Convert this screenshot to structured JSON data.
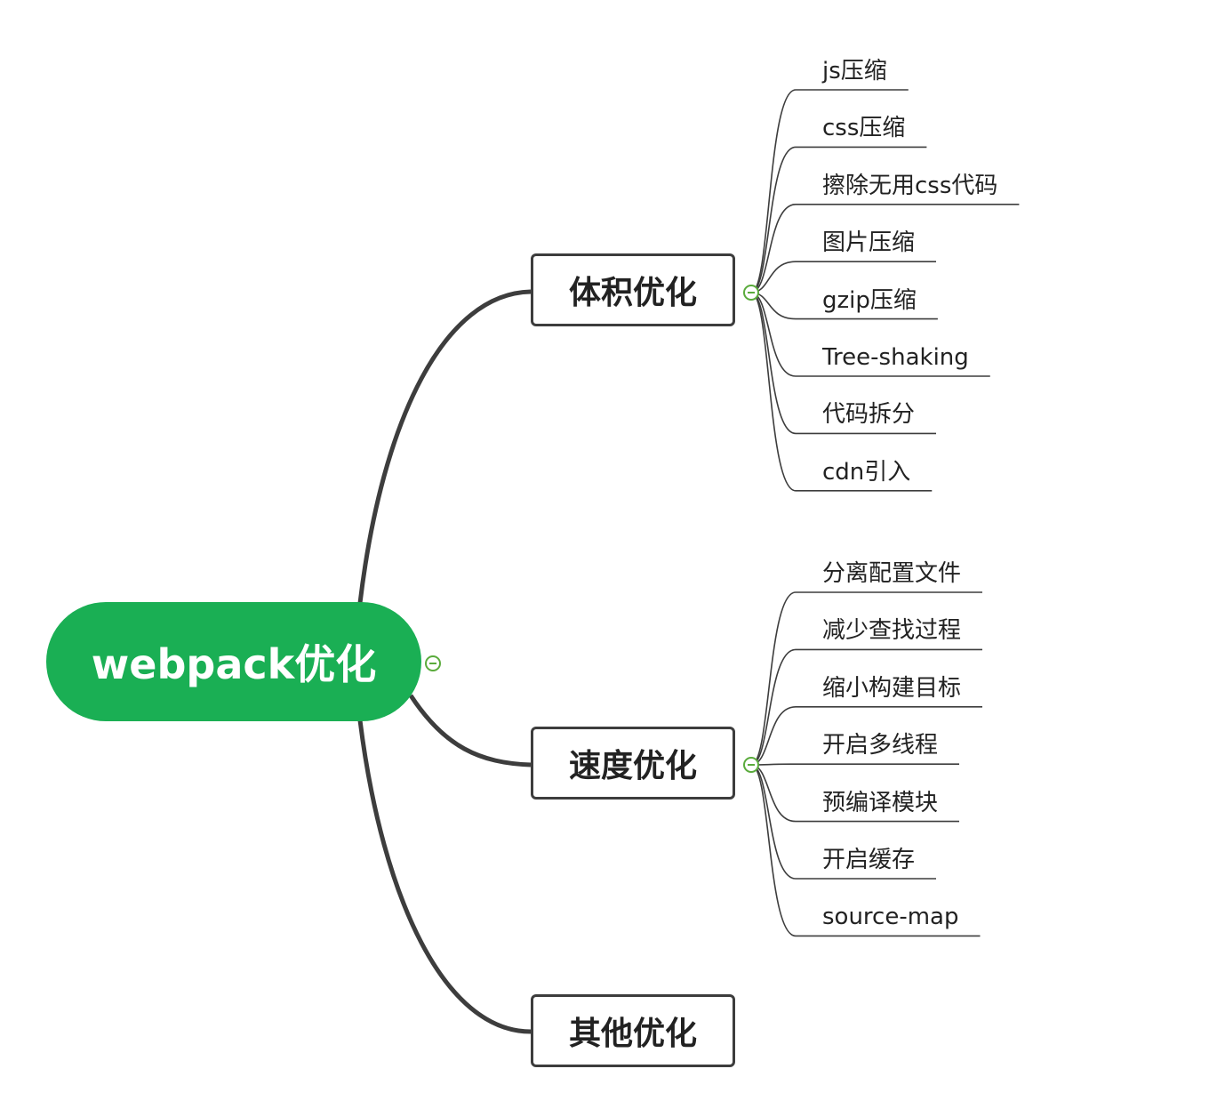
{
  "mindmap": {
    "root": {
      "label": "webpack优化"
    },
    "branches": [
      {
        "label": "体积优化",
        "children": [
          "js压缩",
          "css压缩",
          "擦除无用css代码",
          "图片压缩",
          "gzip压缩",
          "Tree-shaking",
          "代码拆分",
          "cdn引入"
        ]
      },
      {
        "label": "速度优化",
        "children": [
          "分离配置文件",
          "减少查找过程",
          "缩小构建目标",
          "开启多线程",
          "预编译模块",
          "开启缓存",
          "source-map"
        ]
      },
      {
        "label": "其他优化",
        "children": []
      }
    ],
    "colors": {
      "root": "#1aaf54",
      "line": "#3d3d3d",
      "collapse": "#5aab3c"
    }
  }
}
